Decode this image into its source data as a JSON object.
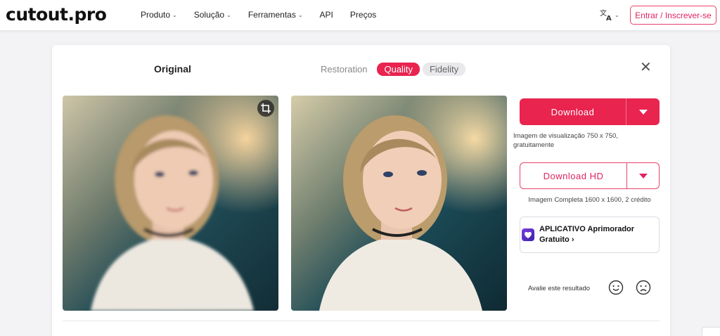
{
  "header": {
    "logo": "cutout.pro",
    "nav": [
      "Produto",
      "Solução",
      "Ferramentas",
      "API",
      "Preços"
    ],
    "login_label": "Entrar / Inscrever-se",
    "lang_icon": "translate-icon"
  },
  "panel": {
    "original_label": "Original",
    "tabs": [
      "Restoration",
      "Quality",
      "Fidelity"
    ],
    "active_tab": "Quality",
    "download_label": "Download",
    "download_note": "Imagem de visualização 750 x 750, gratuitamente",
    "download_hd_label": "Download HD",
    "hd_note": "Imagem Completa 1600 x 1600, 2 crédito",
    "app_promo_line1": "APLICATIVO Aprimorador",
    "app_promo_line2": "Gratuito",
    "rate_label": "Avalie este resultado"
  },
  "colors": {
    "accent": "#e8244f",
    "accent_text": "#e0245e"
  }
}
